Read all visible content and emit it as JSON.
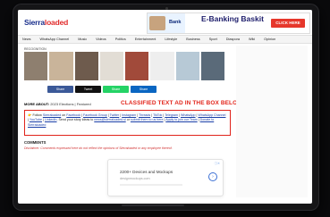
{
  "site": {
    "logo_prefix": "Sierra",
    "logo_suffix": "loaded"
  },
  "top_ad": {
    "brand": "Bank",
    "title": "E-Banking Baskit",
    "cta": "CLICK HERE",
    "colors": {
      "bg": "#e9f3ff",
      "cta": "#e6372b",
      "title": "#1d1d6b"
    }
  },
  "nav": {
    "items": [
      "News",
      "WhatsApp Channel",
      "Music",
      "Videos",
      "Politics",
      "Entertainment",
      "Lifestyle",
      "Business",
      "Sport",
      "Diaspora",
      "Wiki",
      "Opinion"
    ]
  },
  "article": {
    "subhead": "RECOGNITION",
    "thumb_colors": [
      "#8e7f6f",
      "#c9b49a",
      "#6e5b4d",
      "#e2ddd5",
      "#a14a3a",
      "#eeeeee",
      "#b7c9d6",
      "#5a6a79"
    ],
    "share_buttons": [
      {
        "label": "Share",
        "color": "#3b5998"
      },
      {
        "label": "Tweet",
        "color": "#111111"
      },
      {
        "label": "Share",
        "color": "#25d366"
      },
      {
        "label": "Share",
        "color": "#0a66c2"
      }
    ],
    "more_about_label": "MORE ABOUT:",
    "more_about_tags": "2023 Elections | Featured",
    "classified_text": "CLASSIFIED TEXT AD IN THE BOX BELOW",
    "classified_icon": "pointing-hand-icon"
  },
  "follow_box": {
    "parts": [
      {
        "text": "Follow ",
        "link": false
      },
      {
        "text": "Sierraloaded",
        "link": true
      },
      {
        "text": " on ",
        "link": false
      },
      {
        "text": "Facebook",
        "link": true
      },
      {
        "text": " | ",
        "link": false
      },
      {
        "text": "Facebook Group",
        "link": true
      },
      {
        "text": " | ",
        "link": false
      },
      {
        "text": "Twitter",
        "link": true
      },
      {
        "text": " | ",
        "link": false
      },
      {
        "text": "Instagram",
        "link": true
      },
      {
        "text": " | ",
        "link": false
      },
      {
        "text": "Threads",
        "link": true
      },
      {
        "text": " | ",
        "link": false
      },
      {
        "text": "TikTok",
        "link": true
      },
      {
        "text": " | ",
        "link": false
      },
      {
        "text": "Telegram",
        "link": true
      },
      {
        "text": " | ",
        "link": false
      },
      {
        "text": "WhatsApp",
        "link": true
      },
      {
        "text": " | ",
        "link": false
      },
      {
        "text": "WhatsApp Channel",
        "link": true
      },
      {
        "text": " | ",
        "link": false
      },
      {
        "text": "YouTube",
        "link": true
      },
      {
        "text": " | ",
        "link": false
      },
      {
        "text": "LinkedIn",
        "link": true
      },
      {
        "text": ". Send your story ideas to ",
        "link": false
      },
      {
        "text": "news@sierraloaded.sl",
        "link": true
      },
      {
        "text": " or ",
        "link": false
      },
      {
        "text": "submit them to us here",
        "link": true
      },
      {
        "text": " | ",
        "link": false
      },
      {
        "text": "Apply to join our Team",
        "link": true
      },
      {
        "text": " | ",
        "link": false
      },
      {
        "text": "Donate to Sierraloaded",
        "link": true
      }
    ]
  },
  "comments": {
    "heading": "COMMENTS",
    "disclaimer": "Disclaimer: Comments expressed here do not reflect the opinions of Sierraloaded or any employee thereof."
  },
  "bottom_ad": {
    "title": "2200+ Devices and Mockups",
    "subtitle": "designmockups.com"
  }
}
